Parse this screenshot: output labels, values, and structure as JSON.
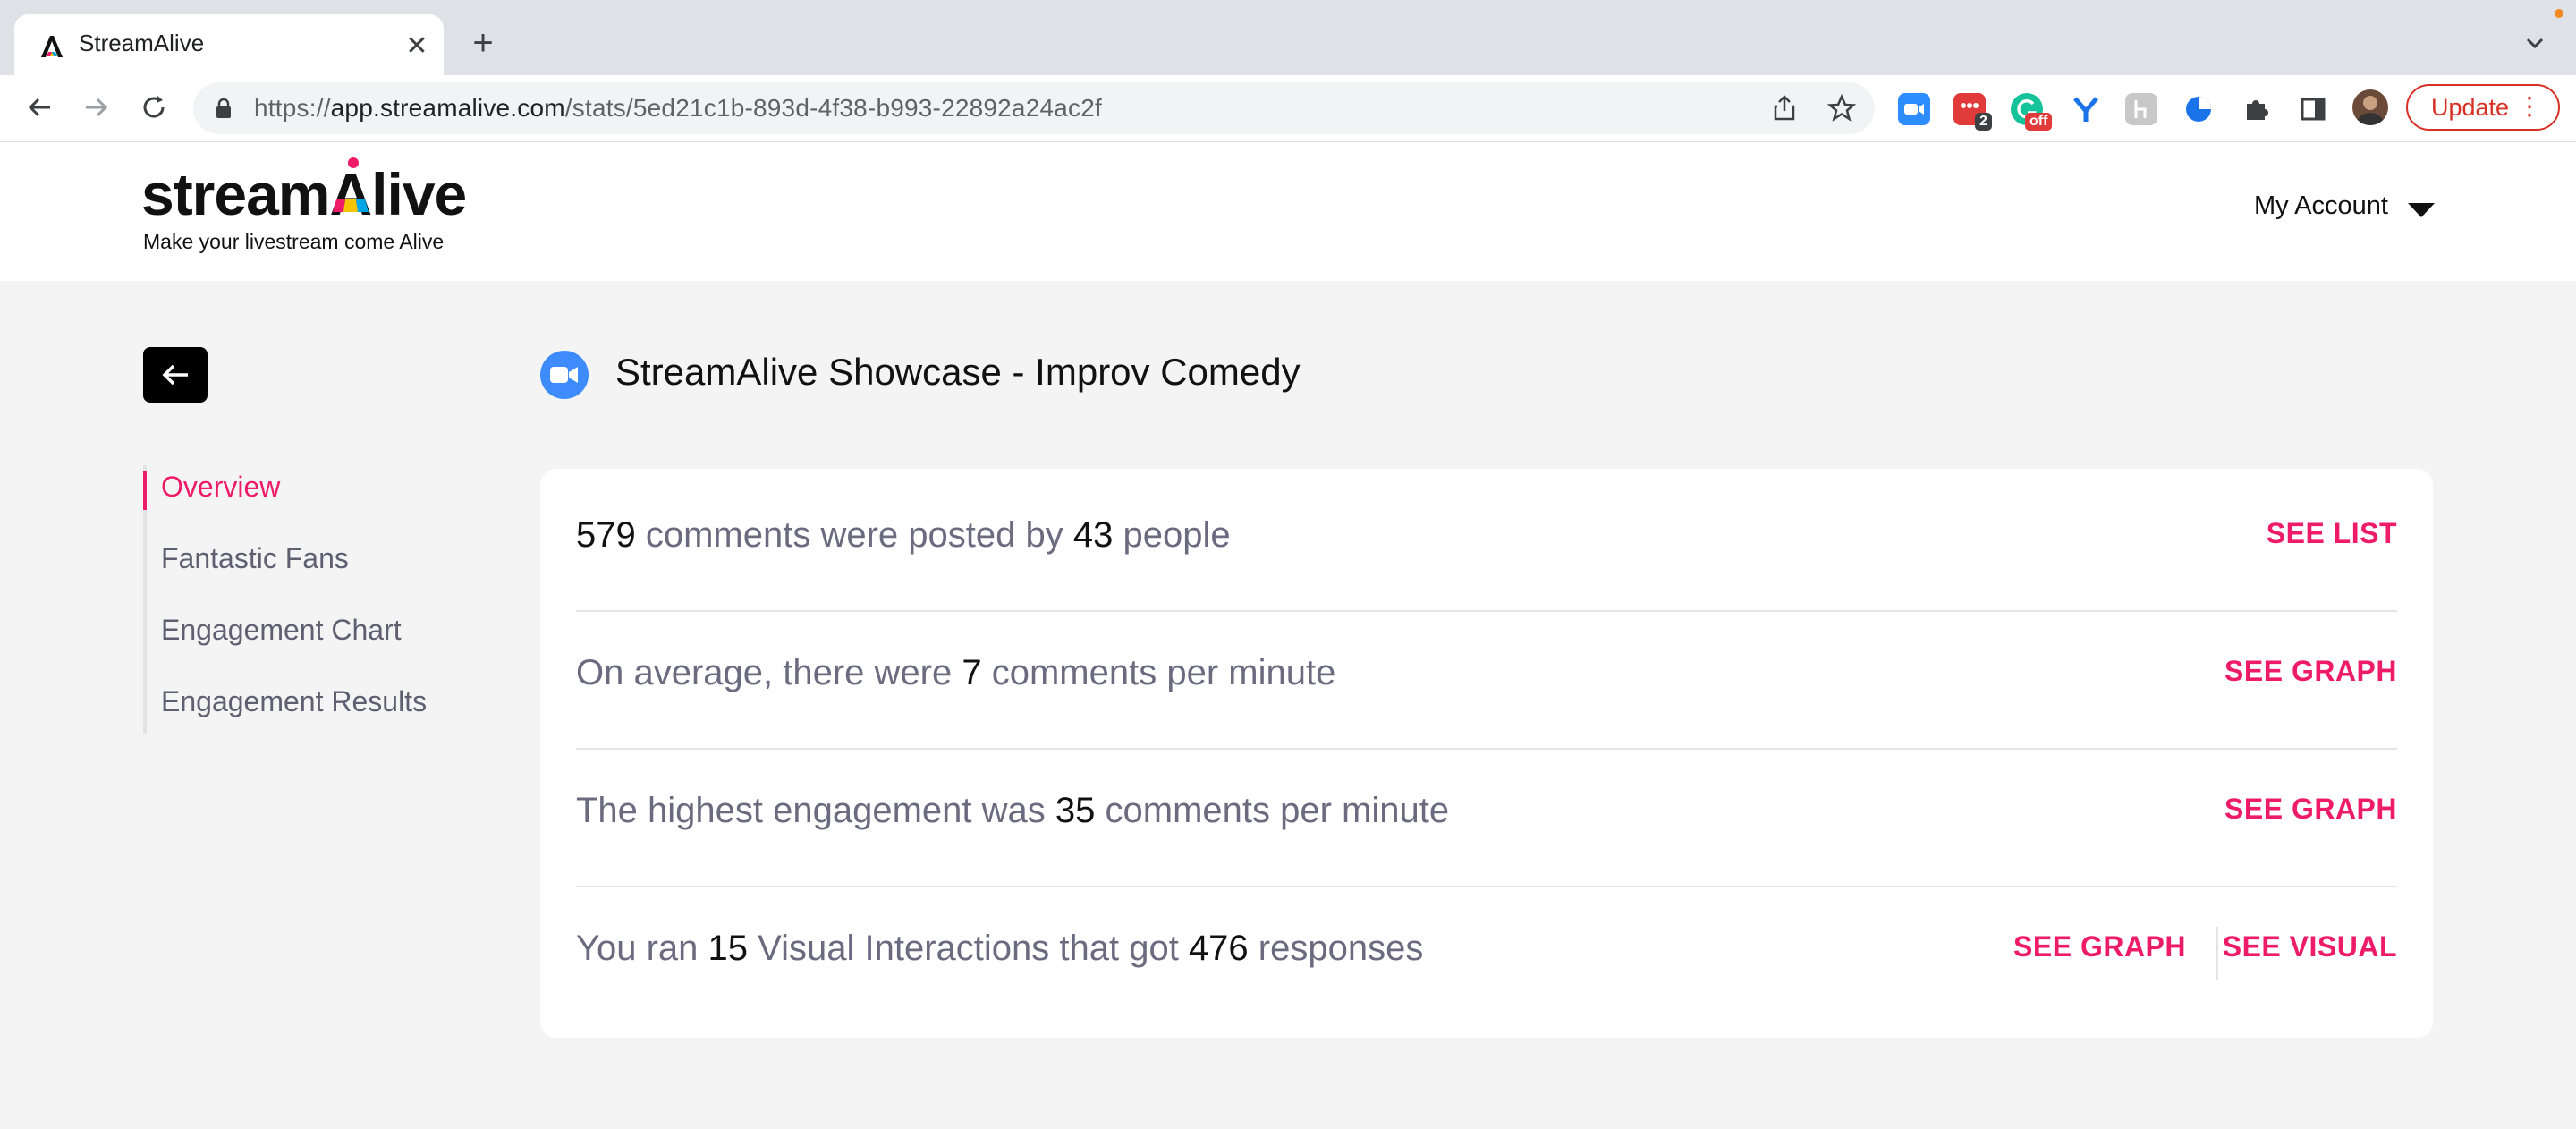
{
  "browser": {
    "tab_title": "StreamAlive",
    "url_scheme": "https://",
    "url_host": "app.streamalive.com",
    "url_path": "/stats/5ed21c1b-893d-4f38-b993-22892a24ac2f",
    "extensions": [
      {
        "icon": "zoom-extension-icon",
        "color": "#2d8cff"
      },
      {
        "icon": "streamalive-extension-icon",
        "color": "#e03a3a",
        "badge": "2"
      },
      {
        "icon": "grammarly-extension-icon",
        "color": "#15c39a",
        "badge": "off"
      },
      {
        "icon": "y-extension-icon",
        "color": "#1a73e8"
      },
      {
        "icon": "h-extension-icon",
        "color": "#bdbdbd"
      },
      {
        "icon": "pie-extension-icon",
        "color": "#1a73e8"
      }
    ],
    "update_label": "Update"
  },
  "header": {
    "logo_text_left": "stream",
    "logo_text_a": "A",
    "logo_text_right": "live",
    "tagline": "Make your livestream come Alive",
    "account_label": "My Account"
  },
  "sidebar": {
    "items": [
      {
        "label": "Overview",
        "active": true
      },
      {
        "label": "Fantastic Fans",
        "active": false
      },
      {
        "label": "Engagement Chart",
        "active": false
      },
      {
        "label": "Engagement Results",
        "active": false
      }
    ]
  },
  "page": {
    "title": "StreamAlive Showcase - Improv Comedy"
  },
  "stats": [
    {
      "parts": [
        {
          "text": "579",
          "num": true
        },
        {
          "text": " comments were posted by ",
          "num": false
        },
        {
          "text": "43",
          "num": true
        },
        {
          "text": " people",
          "num": false
        }
      ],
      "links": [
        "SEE LIST"
      ]
    },
    {
      "parts": [
        {
          "text": "On average, there were ",
          "num": false
        },
        {
          "text": "7",
          "num": true
        },
        {
          "text": " comments per minute",
          "num": false
        }
      ],
      "links": [
        "SEE GRAPH"
      ]
    },
    {
      "parts": [
        {
          "text": "The highest engagement was ",
          "num": false
        },
        {
          "text": "35",
          "num": true
        },
        {
          "text": " comments per minute",
          "num": false
        }
      ],
      "links": [
        "SEE GRAPH"
      ]
    },
    {
      "parts": [
        {
          "text": "You ran ",
          "num": false
        },
        {
          "text": "15",
          "num": true
        },
        {
          "text": " Visual Interactions that got ",
          "num": false
        },
        {
          "text": "476",
          "num": true
        },
        {
          "text": " responses",
          "num": false
        }
      ],
      "links": [
        "SEE GRAPH",
        "SEE VISUAL"
      ]
    }
  ],
  "colors": {
    "accent": "#ee1b68",
    "muted_text": "#6b6b80",
    "background": "#f4f4f5"
  }
}
